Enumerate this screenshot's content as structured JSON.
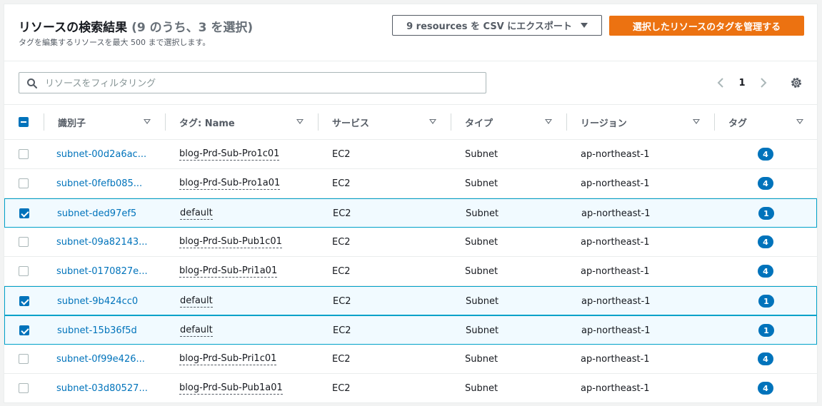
{
  "header": {
    "title": "リソースの検索結果",
    "count_text": "(9 のうち、3 を選択)",
    "subtitle": "タグを編集するリソースを最大 500 まで選択します。",
    "export_label": "9 resources を CSV にエクスポート",
    "manage_tags_label": "選択したリソースのタグを管理する"
  },
  "filter": {
    "placeholder": "リソースをフィルタリング",
    "value": ""
  },
  "pagination": {
    "current_page": "1"
  },
  "columns": [
    "識別子",
    "タグ: Name",
    "サービス",
    "タイプ",
    "リージョン",
    "タグ"
  ],
  "rows": [
    {
      "id": "subnet-00d2a6ac...",
      "name": "blog-Prd-Sub-Pro1c01",
      "service": "EC2",
      "type": "Subnet",
      "region": "ap-northeast-1",
      "tags": "4",
      "selected": false
    },
    {
      "id": "subnet-0fefb085...",
      "name": "blog-Prd-Sub-Pro1a01",
      "service": "EC2",
      "type": "Subnet",
      "region": "ap-northeast-1",
      "tags": "4",
      "selected": false
    },
    {
      "id": "subnet-ded97ef5",
      "name": "default",
      "service": "EC2",
      "type": "Subnet",
      "region": "ap-northeast-1",
      "tags": "1",
      "selected": true
    },
    {
      "id": "subnet-09a82143...",
      "name": "blog-Prd-Sub-Pub1c01",
      "service": "EC2",
      "type": "Subnet",
      "region": "ap-northeast-1",
      "tags": "4",
      "selected": false
    },
    {
      "id": "subnet-0170827e...",
      "name": "blog-Prd-Sub-Pri1a01",
      "service": "EC2",
      "type": "Subnet",
      "region": "ap-northeast-1",
      "tags": "4",
      "selected": false
    },
    {
      "id": "subnet-9b424cc0",
      "name": "default",
      "service": "EC2",
      "type": "Subnet",
      "region": "ap-northeast-1",
      "tags": "1",
      "selected": true
    },
    {
      "id": "subnet-15b36f5d",
      "name": "default",
      "service": "EC2",
      "type": "Subnet",
      "region": "ap-northeast-1",
      "tags": "1",
      "selected": true
    },
    {
      "id": "subnet-0f99e426...",
      "name": "blog-Prd-Sub-Pri1c01",
      "service": "EC2",
      "type": "Subnet",
      "region": "ap-northeast-1",
      "tags": "4",
      "selected": false
    },
    {
      "id": "subnet-03d80527...",
      "name": "blog-Prd-Sub-Pub1a01",
      "service": "EC2",
      "type": "Subnet",
      "region": "ap-northeast-1",
      "tags": "4",
      "selected": false
    }
  ],
  "icons": {
    "search": "search-icon",
    "prev": "chevron-left-icon",
    "next": "chevron-right-icon",
    "settings": "gear-icon",
    "dropdown": "caret-down-icon"
  },
  "colors": {
    "primary": "#ec7211",
    "link": "#0073bb",
    "selected_border": "#00a1c9",
    "selected_bg": "#f1faff"
  }
}
